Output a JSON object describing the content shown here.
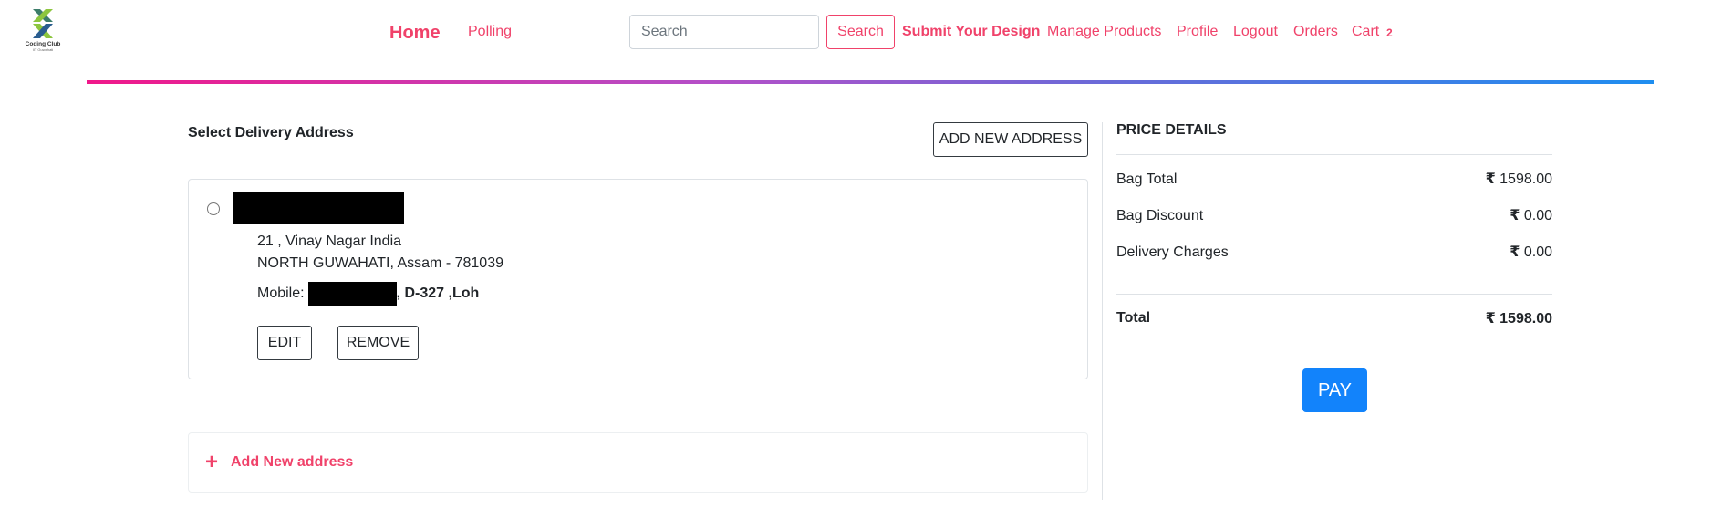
{
  "header": {
    "logo": {
      "text": "Coding Club",
      "sub": "IIT Guwahati"
    },
    "nav": {
      "home": "Home",
      "polling": "Polling",
      "submit_design": "Submit Your Design",
      "manage_products": "Manage Products",
      "profile": "Profile",
      "logout": "Logout",
      "orders": "Orders",
      "cart": "Cart",
      "cart_count": "2"
    },
    "search": {
      "placeholder": "Search",
      "value": "",
      "button_label": "Search"
    }
  },
  "address_section": {
    "heading": "Select Delivery Address",
    "add_new_button": "ADD NEW ADDRESS",
    "address": {
      "line1": "21 , Vinay Nagar India",
      "line2": "NORTH GUWAHATI, Assam - 781039",
      "mobile_label": "Mobile:",
      "mobile_extra": ", D-327 ,Loh",
      "edit_label": "EDIT",
      "remove_label": "REMOVE"
    },
    "add_new_row_label": "Add New address"
  },
  "price_details": {
    "heading": "PRICE DETAILS",
    "currency_symbol": "₹",
    "rows": [
      {
        "label": "Bag Total",
        "value": "1598.00"
      },
      {
        "label": "Bag Discount",
        "value": "0.00"
      },
      {
        "label": "Delivery Charges",
        "value": "0.00"
      }
    ],
    "total_label": "Total",
    "total_value": "1598.00",
    "pay_label": "PAY"
  },
  "colors": {
    "accent": "#f0426a",
    "pay_button": "#1283fb",
    "gradient_start": "#f0188a",
    "gradient_end": "#1e8ef0"
  }
}
